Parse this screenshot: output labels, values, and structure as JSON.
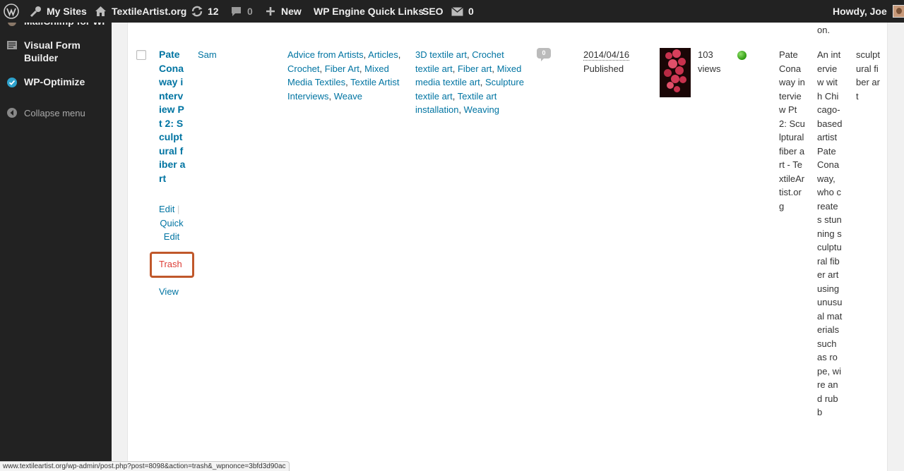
{
  "adminbar": {
    "my_sites": "My Sites",
    "site_name": "TextileArtist.org",
    "updates_count": "12",
    "comments_count": "0",
    "new_label": "New",
    "wpengine": "WP Engine Quick Links",
    "seo": "SEO",
    "mail_count": "0",
    "howdy": "Howdy, Joe"
  },
  "sidebar": {
    "items": [
      {
        "label": "MailChimp for WP",
        "icon": "mailchimp-icon"
      },
      {
        "label": "Visual Form Builder",
        "icon": "form-icon"
      },
      {
        "label": "WP-Optimize",
        "icon": "check-circle-icon"
      }
    ],
    "collapse": "Collapse menu"
  },
  "table": {
    "prev_row_tail": "on.",
    "row": {
      "title": "Pate Conaway interview Pt 2: Sculptural fiber art",
      "actions": {
        "edit": "Edit",
        "quick_edit": "Quick Edit",
        "trash": "Trash",
        "view": "View"
      },
      "author": "Sam",
      "categories": [
        "Advice from Artists",
        "Articles",
        "Crochet",
        "Fiber Art",
        "Mixed Media Textiles",
        "Textile Artist Interviews",
        "Weave"
      ],
      "tags": [
        "3D textile art",
        "Crochet textile art",
        "Fiber art",
        "Mixed media textile art",
        "Sculpture textile art",
        "Textile art installation",
        "Weaving"
      ],
      "comments": "0",
      "date": "2014/04/16",
      "status": "Published",
      "views": "103 views",
      "seo_title": "Pate Conaway interview Pt 2: Sculptural fiber art - TextileArtist.org",
      "meta_desc": "An interview with Chicago-based artist Pate Conaway, who creates stunning sculptural fiber art using unusual materials such as rope, wire and rubb",
      "focus_kw": "sculptural fiber art"
    }
  },
  "statusbar": {
    "url": "www.textileartist.org/wp-admin/post.php?post=8098&action=trash&_wpnonce=3bfd3d90ac"
  },
  "colors": {
    "link": "#0074a2",
    "trash": "#dd3d36",
    "highlight": "#c0582b",
    "adminbar": "#222222"
  }
}
